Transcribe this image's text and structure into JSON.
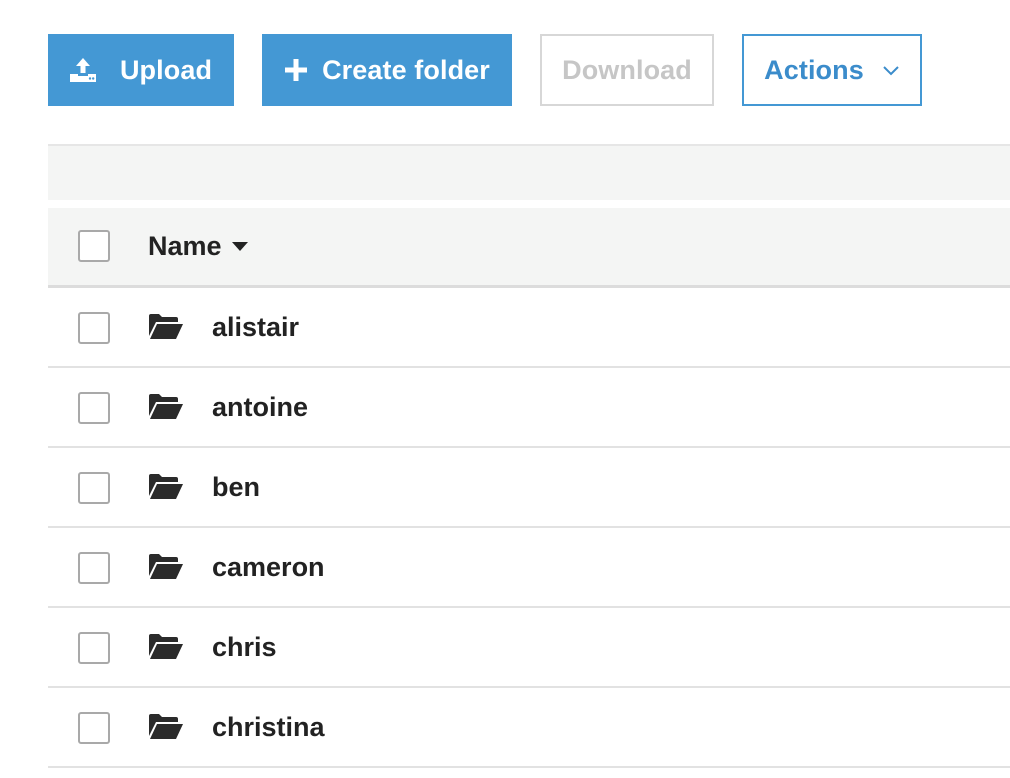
{
  "toolbar": {
    "upload": {
      "label": "Upload",
      "icon": "upload-icon"
    },
    "create_folder": {
      "label": "Create folder",
      "icon": "plus-icon"
    },
    "download": {
      "label": "Download",
      "disabled": true
    },
    "actions": {
      "label": "Actions",
      "icon": "chevron-down-icon"
    }
  },
  "table": {
    "header": {
      "name_label": "Name",
      "sort_icon": "sort-desc-caret-icon"
    },
    "rows": [
      {
        "name": "alistair",
        "icon": "folder-open-icon"
      },
      {
        "name": "antoine",
        "icon": "folder-open-icon"
      },
      {
        "name": "ben",
        "icon": "folder-open-icon"
      },
      {
        "name": "cameron",
        "icon": "folder-open-icon"
      },
      {
        "name": "chris",
        "icon": "folder-open-icon"
      },
      {
        "name": "christina",
        "icon": "folder-open-icon"
      }
    ]
  },
  "colors": {
    "primary": "#4498d4",
    "header_bg": "#f4f5f4",
    "text": "#222222",
    "disabled_text": "#c6c6c6"
  }
}
